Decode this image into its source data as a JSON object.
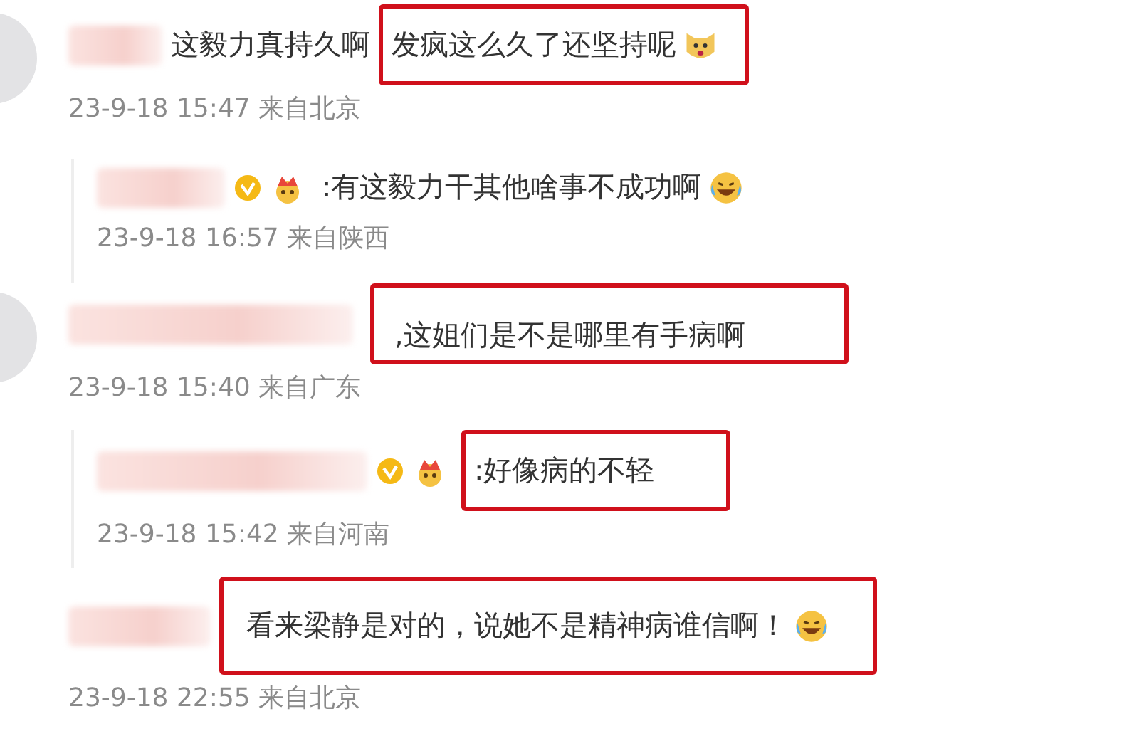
{
  "comments": [
    {
      "kind": "comment",
      "avatar": true,
      "before": "这毅力真持久啊",
      "boxed": true,
      "text": "发疯这么久了还坚持呢",
      "emoji": {
        "kind": "dog"
      },
      "date": "23-9-18 15:47 来自北京"
    },
    {
      "kind": "reply",
      "boxed": false,
      "text": ":有这毅力干其他啥事不成功啊",
      "icons": [
        {
          "kind": "verified"
        },
        {
          "kind": "crown"
        }
      ],
      "emoji": {
        "kind": "laugh-cry"
      },
      "date": "23-9-18 16:57 来自陕西"
    },
    {
      "kind": "comment",
      "avatar": true,
      "boxed": true,
      "text": ",这姐们是不是哪里有手病啊",
      "date": "23-9-18 15:40 来自广东"
    },
    {
      "kind": "reply",
      "boxed": true,
      "text": ":好像病的不轻",
      "icons": [
        {
          "kind": "verified"
        },
        {
          "kind": "crown"
        }
      ],
      "date": "23-9-18 15:42 来自河南"
    },
    {
      "kind": "comment",
      "boxed": true,
      "text": "看来梁静是对的，说她不是精神病谁信啊！",
      "emoji": {
        "kind": "laugh-cry"
      },
      "date": "23-9-18 22:55 来自北京"
    }
  ]
}
